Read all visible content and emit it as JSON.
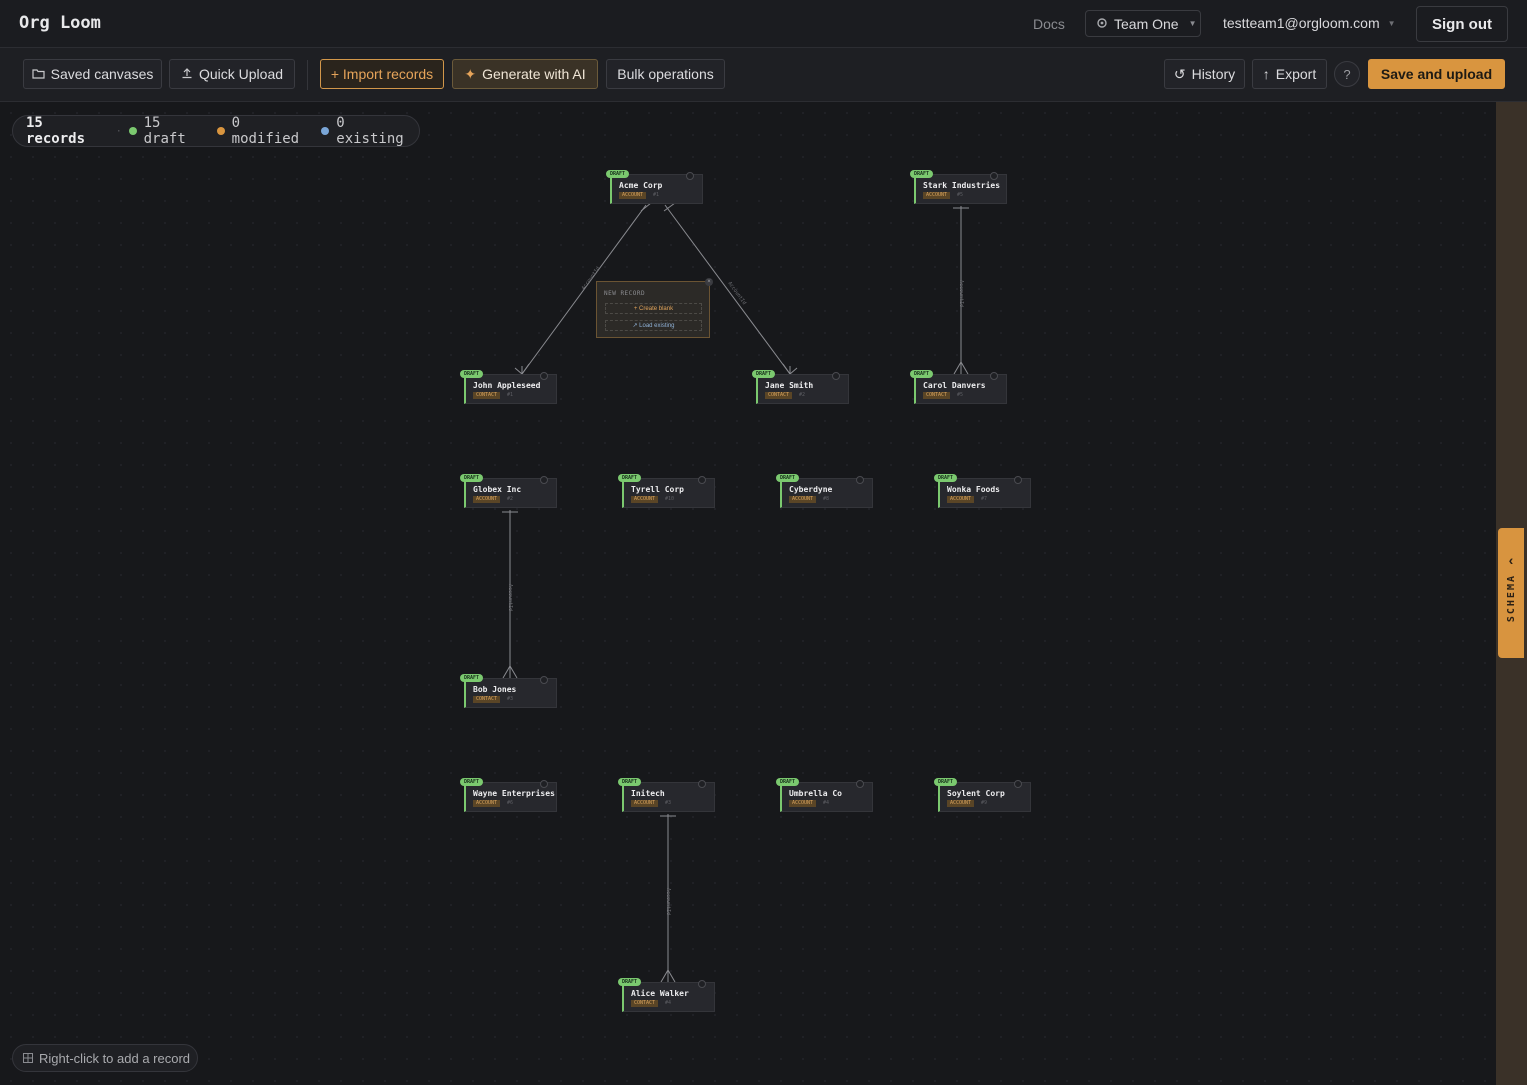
{
  "header": {
    "app_title": "Org Loom",
    "docs_label": "Docs",
    "team_label": "Team One",
    "user_email": "testteam1@orgloom.com",
    "signout_label": "Sign out"
  },
  "toolbar": {
    "saved_canvases": "Saved canvases",
    "quick_upload": "Quick Upload",
    "import_records": "+ Import records",
    "generate_ai": "Generate with AI",
    "bulk_operations": "Bulk operations",
    "history": "History",
    "export": "Export",
    "help": "?",
    "save_upload": "Save and upload"
  },
  "status": {
    "records": "15 records",
    "draft": "15 draft",
    "modified": "0 modified",
    "existing": "0 existing",
    "colors": {
      "draft": "#7bc96f",
      "modified": "#d9953f",
      "existing": "#7aa6d8"
    }
  },
  "hint": "Right-click to add a record",
  "schema_tab": "SCHEMA",
  "new_record_popup": {
    "title": "NEW RECORD",
    "create_blank": "+ Create blank",
    "load_existing": "↗ Load existing"
  },
  "nodes": [
    {
      "name": "Acme Corp",
      "type": "ACCOUNT",
      "id": "#1",
      "status": "DRAFT"
    },
    {
      "name": "Stark Industries",
      "type": "ACCOUNT",
      "id": "#5",
      "status": "DRAFT"
    },
    {
      "name": "John Appleseed",
      "type": "CONTACT",
      "id": "#1",
      "status": "DRAFT"
    },
    {
      "name": "Jane Smith",
      "type": "CONTACT",
      "id": "#2",
      "status": "DRAFT"
    },
    {
      "name": "Carol Danvers",
      "type": "CONTACT",
      "id": "#5",
      "status": "DRAFT"
    },
    {
      "name": "Globex Inc",
      "type": "ACCOUNT",
      "id": "#2",
      "status": "DRAFT"
    },
    {
      "name": "Tyrell Corp",
      "type": "ACCOUNT",
      "id": "#10",
      "status": "DRAFT"
    },
    {
      "name": "Cyberdyne",
      "type": "ACCOUNT",
      "id": "#8",
      "status": "DRAFT"
    },
    {
      "name": "Wonka Foods",
      "type": "ACCOUNT",
      "id": "#7",
      "status": "DRAFT"
    },
    {
      "name": "Bob Jones",
      "type": "CONTACT",
      "id": "#3",
      "status": "DRAFT"
    },
    {
      "name": "Wayne Enterprises",
      "type": "ACCOUNT",
      "id": "#6",
      "status": "DRAFT"
    },
    {
      "name": "Initech",
      "type": "ACCOUNT",
      "id": "#3",
      "status": "DRAFT"
    },
    {
      "name": "Umbrella Co",
      "type": "ACCOUNT",
      "id": "#4",
      "status": "DRAFT"
    },
    {
      "name": "Soylent Corp",
      "type": "ACCOUNT",
      "id": "#9",
      "status": "DRAFT"
    },
    {
      "name": "Alice Walker",
      "type": "CONTACT",
      "id": "#4",
      "status": "DRAFT"
    }
  ],
  "edge_label": "AccountId"
}
